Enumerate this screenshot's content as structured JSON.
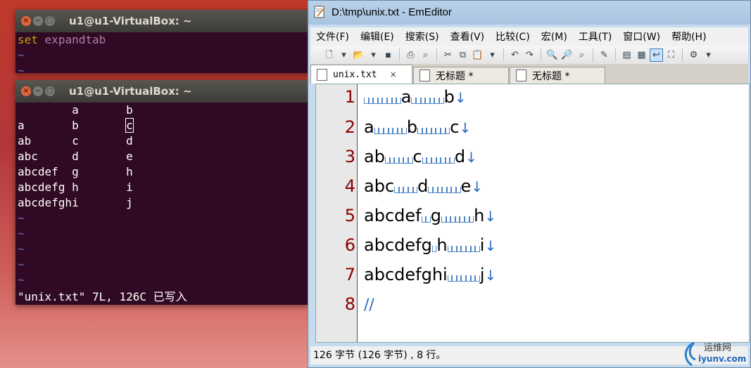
{
  "term1": {
    "title": "u1@u1-VirtualBox: ~",
    "cmd_keyword": "set",
    "cmd_option": "expandtab",
    "tilde": "~"
  },
  "term2": {
    "title": "u1@u1-VirtualBox: ~",
    "lines": [
      "        a       b",
      "a       b       ",
      "ab      c       d",
      "abc     d       e",
      "abcdef  g       h",
      "abcdefg h       i",
      "abcdefghi       j"
    ],
    "cursor_char": "c",
    "tilde": "~",
    "status": "\"unix.txt\" 7L, 126C 已写入"
  },
  "emeditor": {
    "title": "D:\\tmp\\unix.txt - EmEditor",
    "menu": [
      "文件(F)",
      "编辑(E)",
      "搜索(S)",
      "查看(V)",
      "比较(C)",
      "宏(M)",
      "工具(T)",
      "窗口(W)",
      "帮助(H)"
    ],
    "tabs": [
      {
        "label": "unix.txt",
        "close": "×"
      },
      {
        "label": "无标题 *"
      },
      {
        "label": "无标题 *"
      }
    ],
    "line_numbers": [
      "1",
      "2",
      "3",
      "4",
      "5",
      "6",
      "7",
      "8"
    ],
    "return_mark": "↓",
    "eof_mark": "//",
    "status": "126 字节 (126 字节) , 8 行。"
  },
  "watermark": {
    "name": "运维网",
    "url": "iyunv.com"
  },
  "colors": {
    "terminal_bg": "#300a24",
    "vim_tilde": "#6b6bbd",
    "vim_keyword": "#c8a100",
    "line_number": "#8b0000",
    "whitespace_mark": "#4f86c6"
  }
}
